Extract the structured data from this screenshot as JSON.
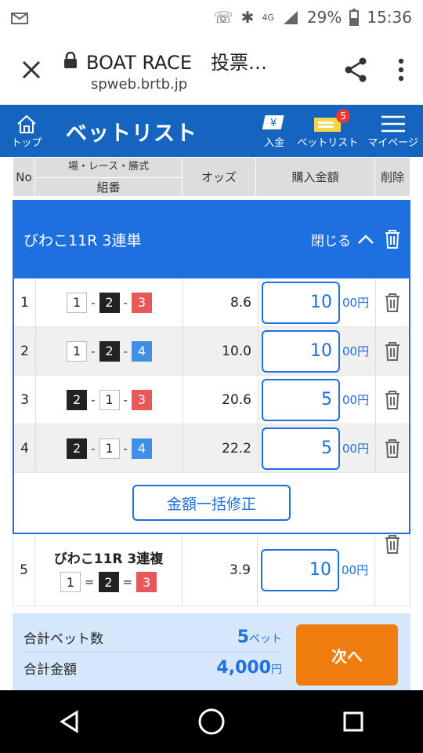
{
  "status": {
    "time": "15:36",
    "battery": "29%",
    "network": "4G"
  },
  "browser": {
    "title": "BOAT RACE　投票…",
    "domain": "spweb.brtb.jp"
  },
  "header": {
    "home_label": "トップ",
    "title": "ベットリスト",
    "deposit_label": "入金",
    "betlist_label": "ベットリスト",
    "betlist_badge": "5",
    "mypage_label": "マイページ"
  },
  "table_header": {
    "no": "No",
    "venue_line": "場・レース・勝式",
    "combo": "組番",
    "odds": "オッズ",
    "amount": "購入金額",
    "delete": "削除"
  },
  "group": {
    "title": "びわこ11R 3連単",
    "close_label": "閉じる"
  },
  "unit": "00円",
  "bets": [
    {
      "no": "1",
      "combo": [
        "1",
        "2",
        "3"
      ],
      "odds": "8.6",
      "amount": "10"
    },
    {
      "no": "2",
      "combo": [
        "1",
        "2",
        "4"
      ],
      "odds": "10.0",
      "amount": "10"
    },
    {
      "no": "3",
      "combo": [
        "2",
        "1",
        "3"
      ],
      "odds": "20.6",
      "amount": "5"
    },
    {
      "no": "4",
      "combo": [
        "2",
        "1",
        "4"
      ],
      "odds": "22.2",
      "amount": "5"
    }
  ],
  "bulk_button": "金額一括修正",
  "bet5": {
    "no": "5",
    "title": "びわこ11R 3連複",
    "combo": [
      "1",
      "2",
      "3"
    ],
    "separator": "=",
    "odds": "3.9",
    "amount": "10"
  },
  "combo_separator": "-",
  "summary": {
    "count_label": "合計ベット数",
    "count_value": "5",
    "count_unit": "ベット",
    "total_label": "合計金額",
    "total_value": "4,000",
    "total_unit": "円",
    "next_label": "次へ"
  },
  "colors": {
    "brand_blue": "#1565c0",
    "accent_orange": "#ef7c0e",
    "boat2": "#222222",
    "boat3": "#e85858",
    "boat4": "#3f8fe6"
  }
}
